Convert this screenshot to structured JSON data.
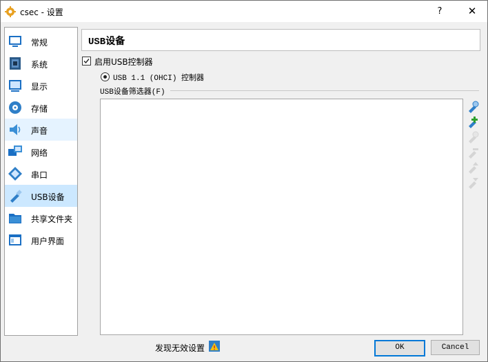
{
  "window": {
    "title": "csec - 设置",
    "help_label": "?",
    "close_label": "✕"
  },
  "sidebar": {
    "items": [
      {
        "label": "常规",
        "icon": "general-icon"
      },
      {
        "label": "系统",
        "icon": "system-icon"
      },
      {
        "label": "显示",
        "icon": "display-icon"
      },
      {
        "label": "存储",
        "icon": "storage-icon"
      },
      {
        "label": "声音",
        "icon": "audio-icon"
      },
      {
        "label": "网络",
        "icon": "network-icon"
      },
      {
        "label": "串口",
        "icon": "serial-icon"
      },
      {
        "label": "USB设备",
        "icon": "usb-icon"
      },
      {
        "label": "共享文件夹",
        "icon": "shared-folder-icon"
      },
      {
        "label": "用户界面",
        "icon": "user-interface-icon"
      }
    ],
    "selected_index": 7,
    "hover_index": 4
  },
  "page": {
    "title": "USB设备",
    "enable_usb_label": "启用USB控制器",
    "enable_usb_checked": true,
    "controller_option": "USB 1.1 (OHCI) 控制器",
    "filters_label": "USB设备筛选器(F)"
  },
  "footer": {
    "warning_text": "发现无效设置",
    "ok_label": "OK",
    "cancel_label": "Cancel"
  },
  "colors": {
    "accent": "#0078d7",
    "selected_bg": "#cce8ff",
    "hover_bg": "#e5f3ff"
  }
}
